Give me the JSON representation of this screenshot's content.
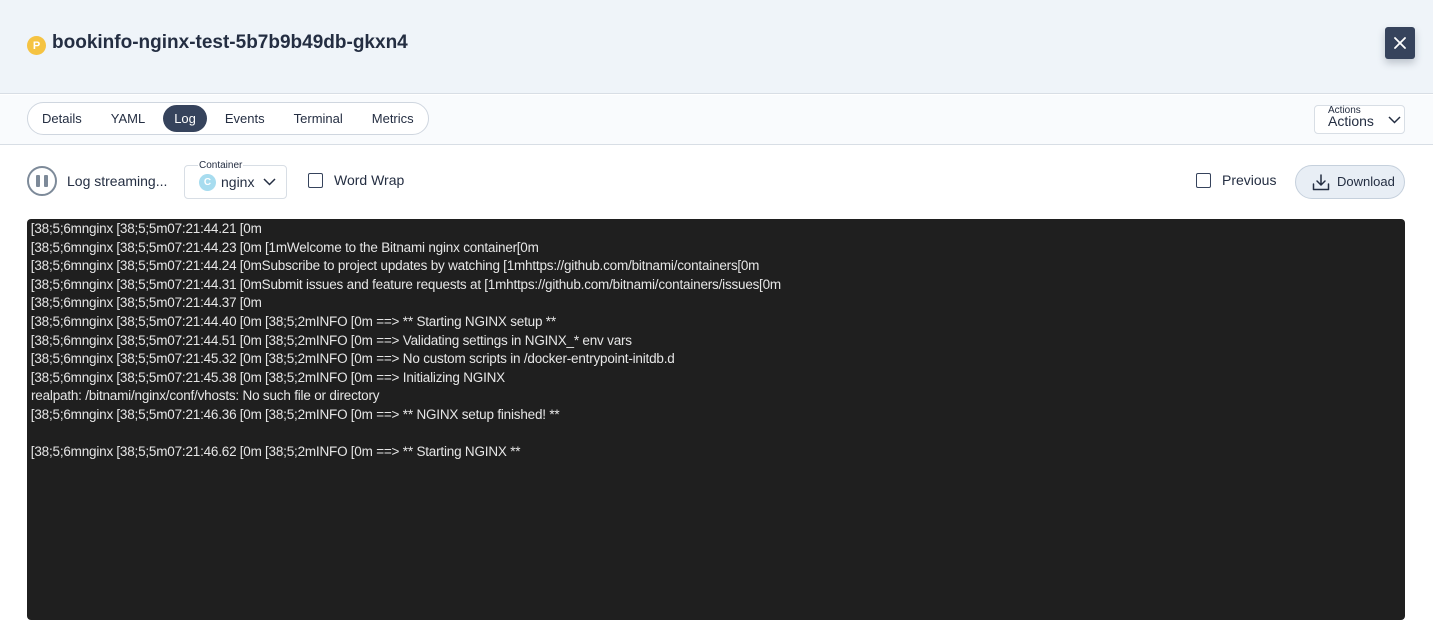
{
  "header": {
    "pod_badge": "P",
    "title": "bookinfo-nginx-test-5b7b9b49db-gkxn4",
    "close_icon": "close-icon"
  },
  "tabs": [
    {
      "label": "Details",
      "active": false
    },
    {
      "label": "YAML",
      "active": false
    },
    {
      "label": "Log",
      "active": true
    },
    {
      "label": "Events",
      "active": false
    },
    {
      "label": "Terminal",
      "active": false
    },
    {
      "label": "Metrics",
      "active": false
    }
  ],
  "actions": {
    "small_label": "Actions",
    "label": "Actions"
  },
  "toolbar": {
    "stream_label": "Log streaming...",
    "container_small_label": "Container",
    "container_badge": "C",
    "container_value": "nginx",
    "word_wrap_label": "Word Wrap",
    "previous_label": "Previous",
    "download_label": "Download"
  },
  "log": {
    "lines": [
      "\u001b[38;5;6mnginx \u001b[38;5;5m07:21:44.21 \u001b[0m",
      "\u001b[38;5;6mnginx \u001b[38;5;5m07:21:44.23 \u001b[0m \u001b[1mWelcome to the Bitnami nginx container\u001b[0m",
      "\u001b[38;5;6mnginx \u001b[38;5;5m07:21:44.24 \u001b[0mSubscribe to project updates by watching \u001b[1mhttps://github.com/bitnami/containers\u001b[0m",
      "\u001b[38;5;6mnginx \u001b[38;5;5m07:21:44.31 \u001b[0mSubmit issues and feature requests at \u001b[1mhttps://github.com/bitnami/containers/issues\u001b[0m",
      "\u001b[38;5;6mnginx \u001b[38;5;5m07:21:44.37 \u001b[0m",
      "\u001b[38;5;6mnginx \u001b[38;5;5m07:21:44.40 \u001b[0m \u001b[38;5;2mINFO \u001b[0m ==> ** Starting NGINX setup **",
      "\u001b[38;5;6mnginx \u001b[38;5;5m07:21:44.51 \u001b[0m \u001b[38;5;2mINFO \u001b[0m ==> Validating settings in NGINX_* env vars",
      "\u001b[38;5;6mnginx \u001b[38;5;5m07:21:45.32 \u001b[0m \u001b[38;5;2mINFO \u001b[0m ==> No custom scripts in /docker-entrypoint-initdb.d",
      "\u001b[38;5;6mnginx \u001b[38;5;5m07:21:45.38 \u001b[0m \u001b[38;5;2mINFO \u001b[0m ==> Initializing NGINX",
      "realpath: /bitnami/nginx/conf/vhosts: No such file or directory",
      "\u001b[38;5;6mnginx \u001b[38;5;5m07:21:46.36 \u001b[0m \u001b[38;5;2mINFO \u001b[0m ==> ** NGINX setup finished! **",
      "",
      "\u001b[38;5;6mnginx \u001b[38;5;5m07:21:46.62 \u001b[0m \u001b[38;5;2mINFO \u001b[0m ==> ** Starting NGINX **"
    ]
  },
  "colors": {
    "accent_dark": "#36435c",
    "header_bg": "#eff4f9",
    "log_bg": "#1f1f1f",
    "pod_badge": "#f5c342",
    "container_badge": "#a7dcef"
  }
}
